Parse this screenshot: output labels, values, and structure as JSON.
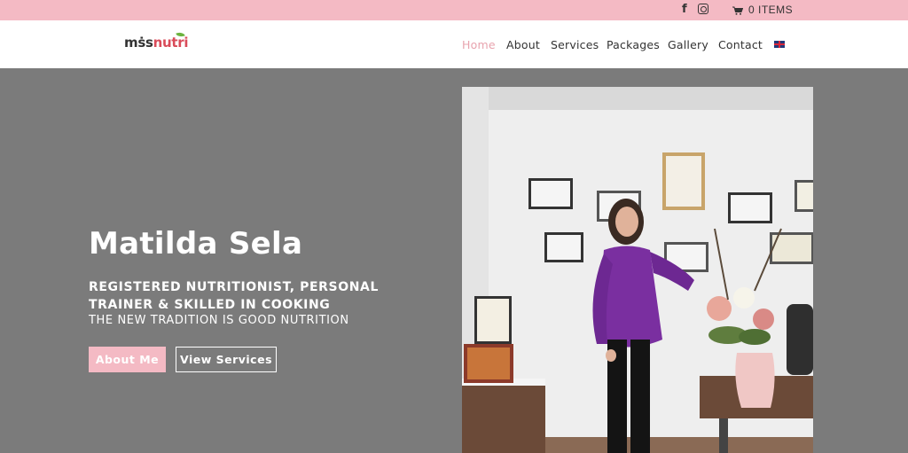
{
  "topbar": {
    "social": {
      "facebook_icon": "facebook-icon",
      "instagram_icon": "instagram-icon"
    },
    "cart_label": "0 ITEMS",
    "cart_icon": "cart-icon",
    "background": "#f4bac4"
  },
  "header": {
    "logo_part1": "mṡs",
    "logo_part2": "nutri",
    "nav": [
      {
        "label": "Home",
        "active": true
      },
      {
        "label": "About"
      },
      {
        "label": "Services"
      },
      {
        "label": "Packages"
      },
      {
        "label": "Gallery"
      },
      {
        "label": "Contact"
      }
    ],
    "language_icon": "uk-flag-icon",
    "active_color": "#e8a3ae"
  },
  "hero": {
    "title": "Matilda Sela",
    "subtitle": "REGISTERED NUTRITIONIST, PERSONAL TRAINER & SKILLED IN COOKING",
    "tagline": "THE NEW TRADITION IS GOOD NUTRITION",
    "buttons": {
      "about": "About Me",
      "services": "View Services"
    },
    "accent": "#f4bac4"
  }
}
